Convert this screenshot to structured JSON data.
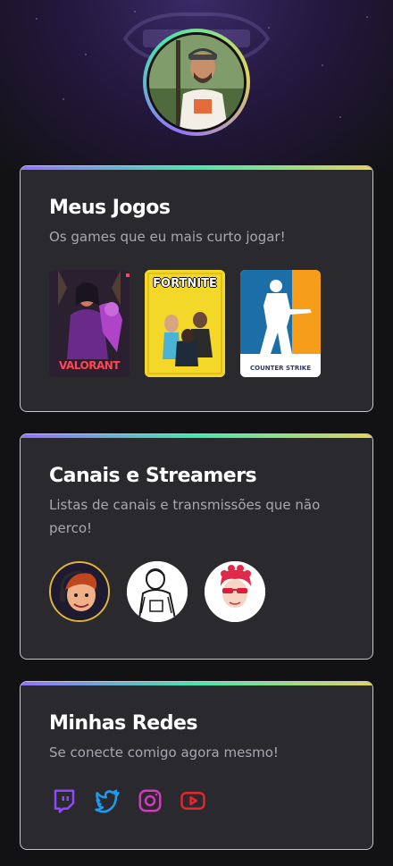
{
  "profile": {
    "avatar_alt": "Foto de perfil"
  },
  "games_card": {
    "title": "Meus Jogos",
    "subtitle": "Os games que eu mais curto jogar!",
    "games": [
      {
        "caption": "VALORANT",
        "color": "#e84057"
      },
      {
        "caption": "FORTNITE",
        "color": "#f5dd2a"
      },
      {
        "caption": "COUNTER STRIKE",
        "color": "#f7a12c"
      }
    ]
  },
  "streamers_card": {
    "title": "Canais e Streamers",
    "subtitle": "Listas de canais e transmissões que não perco!"
  },
  "social_card": {
    "title": "Minhas Redes",
    "subtitle": "Se conecte comigo agora mesmo!",
    "icons": [
      {
        "name": "twitch-icon",
        "color": "#9146ff"
      },
      {
        "name": "twitter-icon",
        "color": "#1d9bf0"
      },
      {
        "name": "instagram-icon",
        "color": "#c13584"
      },
      {
        "name": "youtube-icon",
        "color": "#ff0000"
      }
    ]
  },
  "colors": {
    "background": "#121214",
    "card": "#29292e",
    "gradient_start": "#9572fc",
    "gradient_mid": "#43e7ad",
    "gradient_end": "#e2d45c"
  }
}
